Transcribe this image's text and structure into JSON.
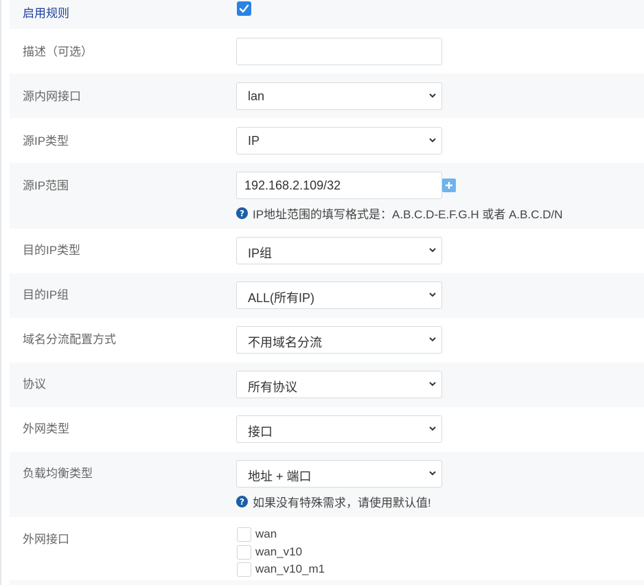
{
  "form": {
    "enable_rule": {
      "label": "启用规则",
      "checked": true
    },
    "description": {
      "label": "描述（可选）",
      "value": "",
      "placeholder": ""
    },
    "src_interface": {
      "label": "源内网接口",
      "value": "lan"
    },
    "src_ip_type": {
      "label": "源IP类型",
      "value": "IP"
    },
    "src_ip_range": {
      "label": "源IP范围",
      "value": "192.168.2.109/32",
      "hint": "IP地址范围的填写格式是：A.B.C.D-E.F.G.H 或者 A.B.C.D/N"
    },
    "dst_ip_type": {
      "label": "目的IP类型",
      "value": "IP组"
    },
    "dst_ip_group": {
      "label": "目的IP组",
      "value": "ALL(所有IP)"
    },
    "domain_split": {
      "label": "域名分流配置方式",
      "value": "不用域名分流"
    },
    "protocol": {
      "label": "协议",
      "value": "所有协议"
    },
    "wan_type": {
      "label": "外网类型",
      "value": "接口"
    },
    "lb_type": {
      "label": "负载均衡类型",
      "value": "地址 + 端口",
      "hint": "如果没有特殊需求，请使用默认值!"
    },
    "wan_interfaces": {
      "label": "外网接口",
      "options": [
        {
          "label": "wan",
          "checked": false
        },
        {
          "label": "wan_v10",
          "checked": false
        },
        {
          "label": "wan_v10_m1",
          "checked": false
        }
      ]
    }
  },
  "colors": {
    "accent": "#2a82e4",
    "label_active": "#1b3f9b",
    "row_alt": "#f7f8f9",
    "plus_button": "#6fb3ee"
  },
  "icons": {
    "select_arrow": "chevron-down-icon",
    "help": "question-circle-icon",
    "add": "plus-icon",
    "check": "check-icon"
  }
}
